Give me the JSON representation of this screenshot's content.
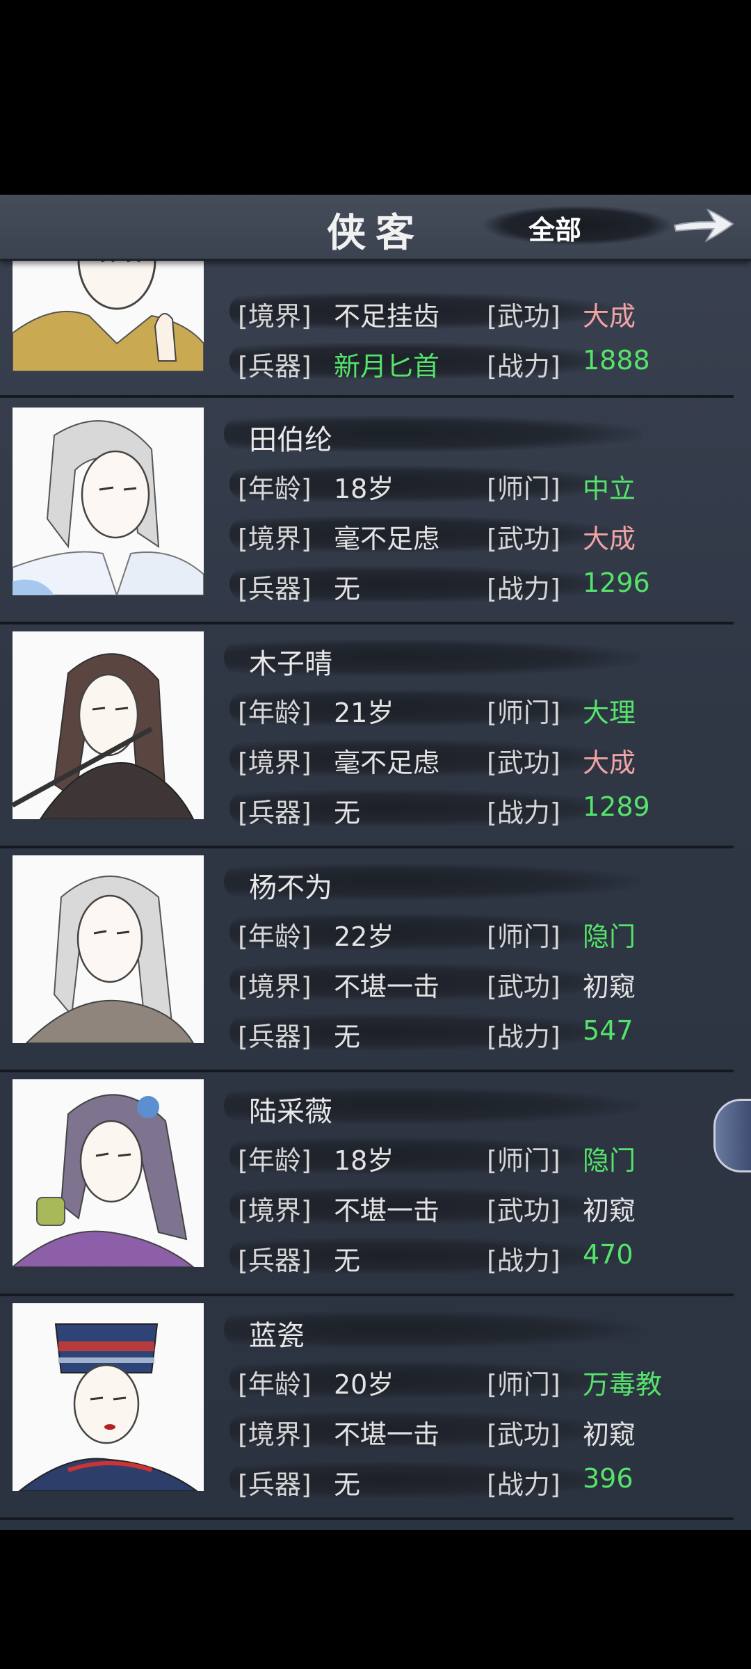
{
  "header": {
    "title": "侠客",
    "filter_label": "全部"
  },
  "labels": {
    "age": "[年龄]",
    "sect": "[师门]",
    "realm": "[境界]",
    "martial": "[武功]",
    "weapon": "[兵器]",
    "power": "[战力]"
  },
  "characters": [
    {
      "name": "",
      "age": "",
      "sect": "",
      "realm": "不足挂齿",
      "martial": "大成",
      "weapon": "新月匕首",
      "power": "1888",
      "weapon_color": "green",
      "martial_color": "pink"
    },
    {
      "name": "田伯纶",
      "age": "18岁",
      "sect": "中立",
      "realm": "毫不足虑",
      "martial": "大成",
      "weapon": "无",
      "power": "1296"
    },
    {
      "name": "木子晴",
      "age": "21岁",
      "sect": "大理",
      "realm": "毫不足虑",
      "martial": "大成",
      "weapon": "无",
      "power": "1289"
    },
    {
      "name": "杨不为",
      "age": "22岁",
      "sect": "隐门",
      "realm": "不堪一击",
      "martial": "初窥",
      "weapon": "无",
      "power": "547"
    },
    {
      "name": "陆采薇",
      "age": "18岁",
      "sect": "隐门",
      "realm": "不堪一击",
      "martial": "初窥",
      "weapon": "无",
      "power": "470"
    },
    {
      "name": "蓝瓷",
      "age": "20岁",
      "sect": "万毒教",
      "realm": "不堪一击",
      "martial": "初窥",
      "weapon": "无",
      "power": "396"
    }
  ],
  "colors": {
    "green": "#55e36b",
    "pink": "#f0a3a3",
    "panel": "#2f3644"
  }
}
